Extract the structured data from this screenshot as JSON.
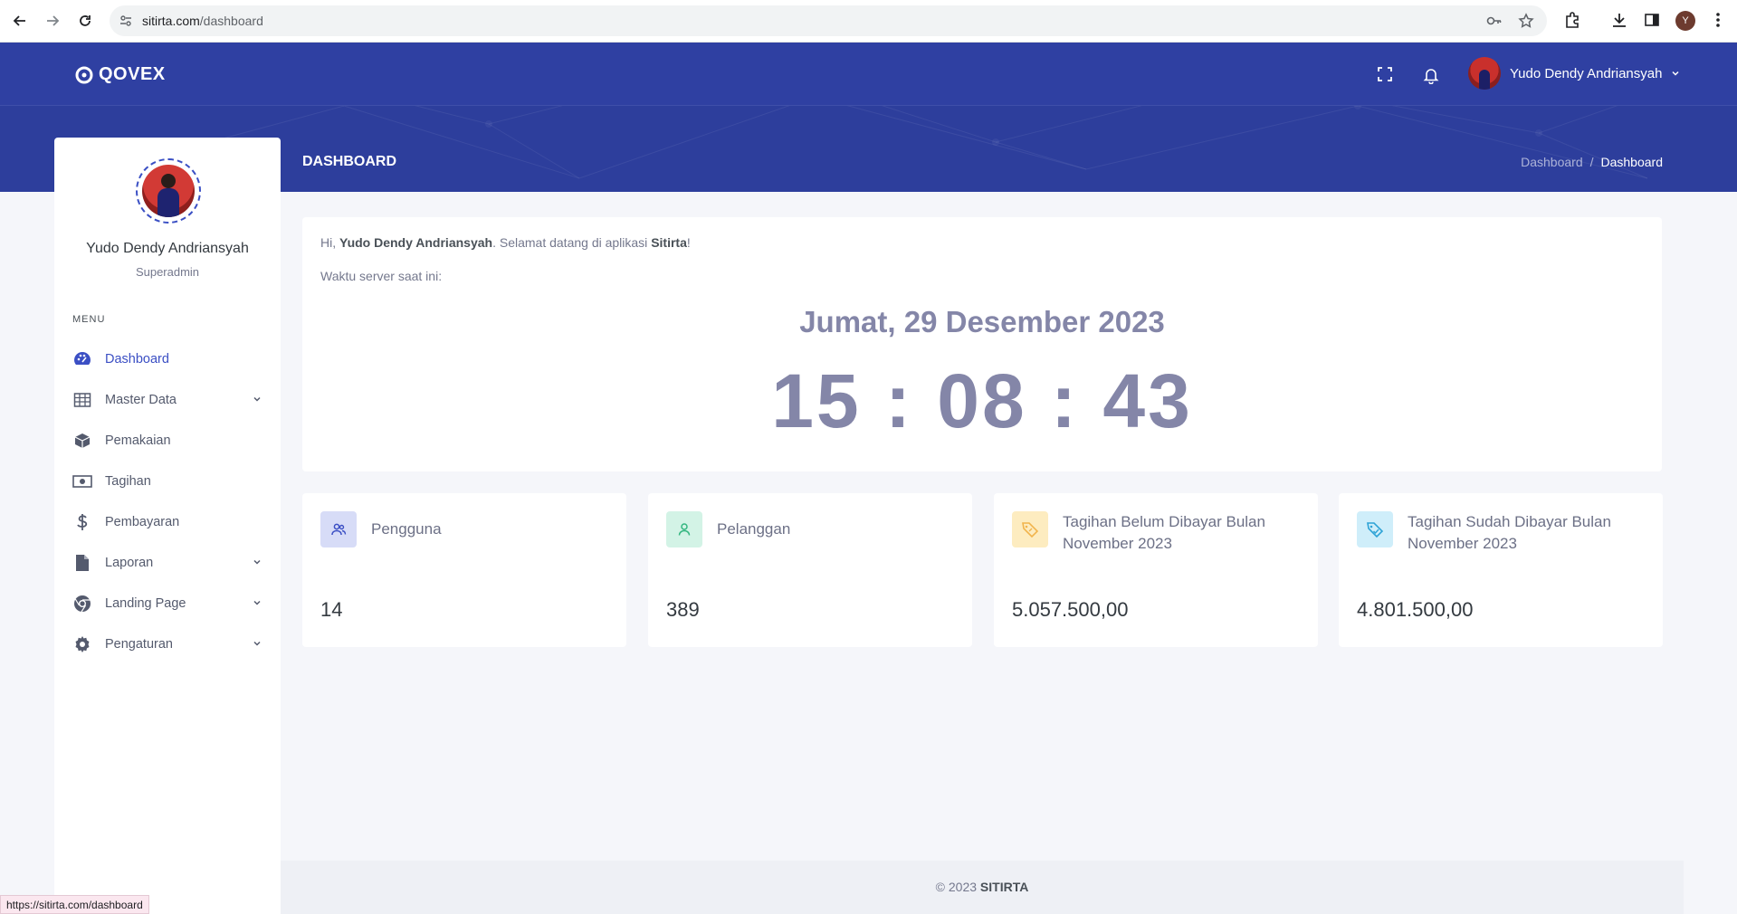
{
  "browser": {
    "url_host": "sitirta.com",
    "url_path": "/dashboard",
    "profile_initial": "Y",
    "status_url": "https://sitirta.com/dashboard"
  },
  "header": {
    "logo_text": "QOVEX",
    "user_name": "Yudo Dendy Andriansyah",
    "page_title": "DASHBOARD",
    "breadcrumb": [
      "Dashboard",
      "/",
      "Dashboard"
    ]
  },
  "sidebar": {
    "user_name": "Yudo Dendy Andriansyah",
    "user_role": "Superadmin",
    "menu_title": "MENU",
    "items": [
      {
        "label": "Dashboard",
        "icon": "palette-icon"
      },
      {
        "label": "Master Data",
        "icon": "table-icon"
      },
      {
        "label": "Pemakaian",
        "icon": "cube-icon"
      },
      {
        "label": "Tagihan",
        "icon": "money-bill-icon"
      },
      {
        "label": "Pembayaran",
        "icon": "dollar-icon"
      },
      {
        "label": "Laporan",
        "icon": "file-icon"
      },
      {
        "label": "Landing Page",
        "icon": "chrome-icon"
      },
      {
        "label": "Pengaturan",
        "icon": "gear-icon"
      }
    ]
  },
  "welcome": {
    "hi": "Hi, ",
    "name": "Yudo Dendy Andriansyah",
    "middle": ". Selamat datang di aplikasi ",
    "app": "Sitirta",
    "end": "!",
    "server_time_label": "Waktu server saat ini:",
    "date": "Jumat, 29 Desember 2023",
    "time": "15 : 08 : 43"
  },
  "stats": [
    {
      "label": "Pengguna",
      "value": "14",
      "icon": "users-icon",
      "color": "#d7dcf7"
    },
    {
      "label": "Pelanggan",
      "value": "389",
      "icon": "user-icon",
      "color": "#d3f3e6"
    },
    {
      "label": "Tagihan Belum Dibayar Bulan November 2023",
      "value": "5.057.500,00",
      "icon": "tag-icon",
      "color": "#fdecc0"
    },
    {
      "label": "Tagihan Sudah Dibayar Bulan November 2023",
      "value": "4.801.500,00",
      "icon": "tag-icon",
      "color": "#cfeefa"
    }
  ],
  "footer": {
    "copy": "© 2023 ",
    "brand": "SITIRTA"
  },
  "colors": {
    "primary": "#2f40a2",
    "accent": "#3b4fc4",
    "clock": "#8486a8"
  }
}
